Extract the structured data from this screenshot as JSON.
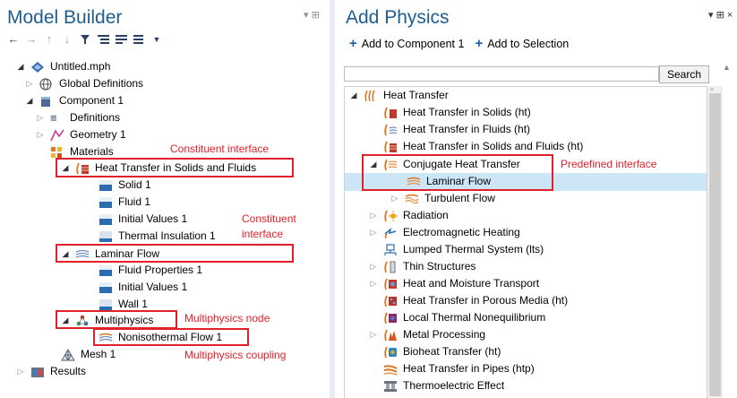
{
  "left_panel": {
    "title": "Model Builder",
    "controls": "▾ ⊞",
    "toolbar": [
      "back-arrow",
      "forward-arrow",
      "up-arrow",
      "down-arrow",
      "filter",
      "expand-all",
      "collapse-all",
      "menu",
      "dropdown"
    ],
    "tree": {
      "root": "Untitled.mph",
      "global_definitions": "Global Definitions",
      "component": "Component 1",
      "definitions": "Definitions",
      "geometry": "Geometry 1",
      "materials": "Materials",
      "ht": "Heat Transfer in Solids and Fluids",
      "solid": "Solid 1",
      "fluid": "Fluid 1",
      "initial_values": "Initial Values 1",
      "thermal_insulation": "Thermal Insulation 1",
      "laminar": "Laminar Flow",
      "fluid_props": "Fluid Properties 1",
      "initial_values_2": "Initial Values 1",
      "wall": "Wall 1",
      "multiphysics": "Multiphysics",
      "nonisothermal": "Nonisothermal Flow 1",
      "mesh": "Mesh 1",
      "results": "Results"
    },
    "annotations": {
      "constituent_1": "Constituent interface",
      "constituent_2a": "Constituent",
      "constituent_2b": "interface",
      "multiphysics_node": "Multiphysics node",
      "multiphysics_coupling": "Multiphysics coupling"
    }
  },
  "right_panel": {
    "title": "Add Physics",
    "controls": "▾ ⊞ ×",
    "add_to_component": "Add to Component 1",
    "add_to_selection": "Add to Selection",
    "search_value": "",
    "search_button": "Search",
    "list": {
      "heat_transfer": "Heat Transfer",
      "solids": "Heat Transfer in Solids (ht)",
      "fluids": "Heat Transfer in Fluids (ht)",
      "solids_fluids": "Heat Transfer in Solids and Fluids (ht)",
      "conjugate": "Conjugate Heat Transfer",
      "laminar": "Laminar Flow",
      "turbulent": "Turbulent Flow",
      "radiation": "Radiation",
      "em_heating": "Electromagnetic Heating",
      "lumped": "Lumped Thermal System (lts)",
      "thin": "Thin Structures",
      "moisture": "Heat and Moisture Transport",
      "porous": "Heat Transfer in Porous Media (ht)",
      "ltne": "Local Thermal Nonequilibrium",
      "metal": "Metal Processing",
      "bioheat": "Bioheat Transfer (ht)",
      "pipes": "Heat Transfer in Pipes (htp)",
      "thermoelectric": "Thermoelectric Effect"
    },
    "annotation": "Predefined interface"
  },
  "colors": {
    "title_blue": "#1f5d8f",
    "highlight_red": "#e0202a",
    "selection_blue": "#cde6f7"
  }
}
